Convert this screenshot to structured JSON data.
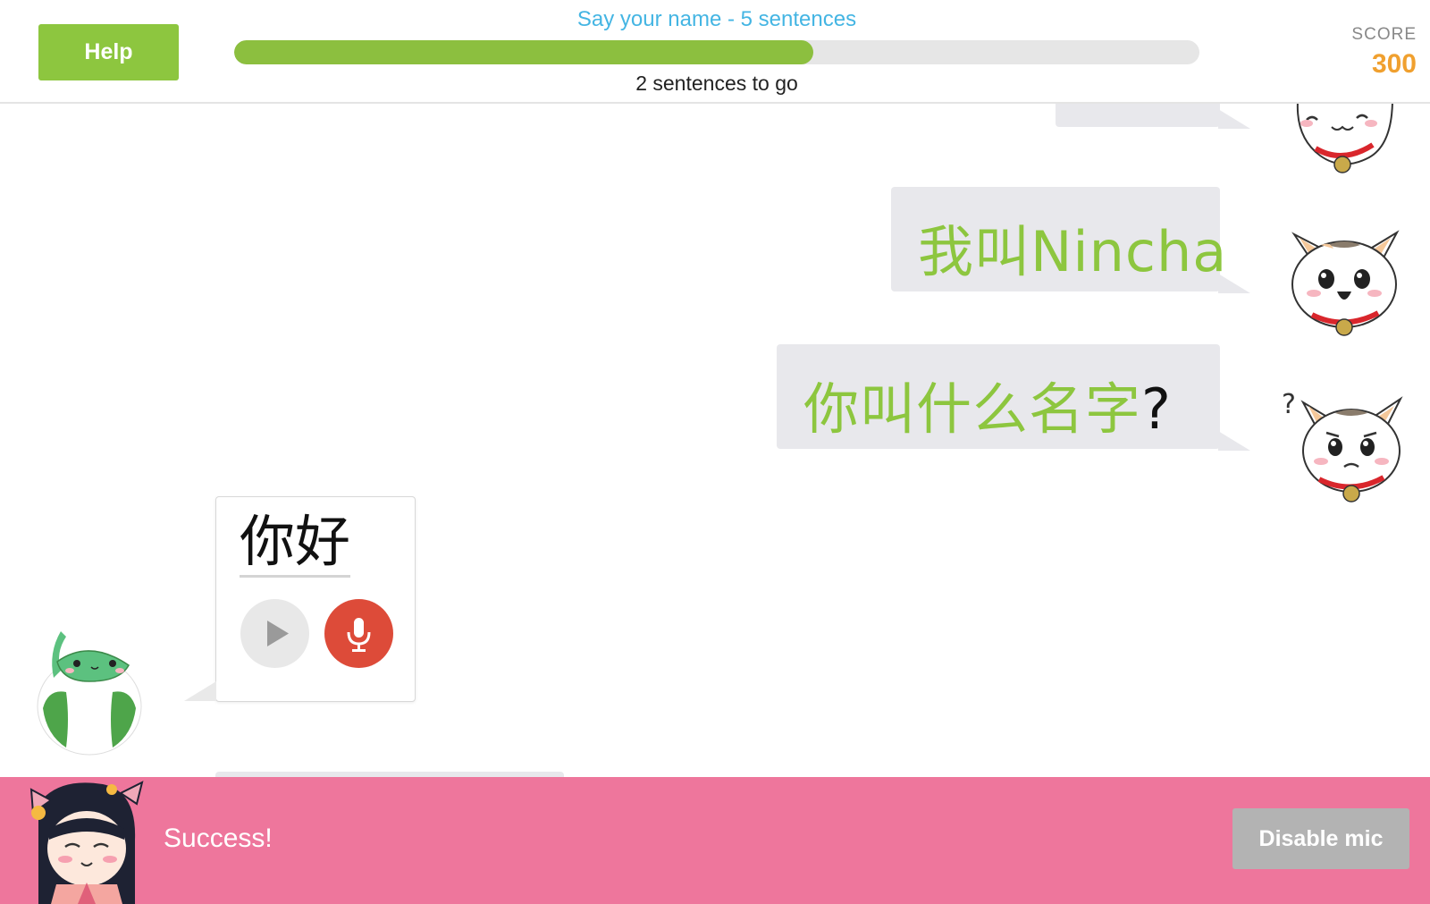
{
  "header": {
    "help_label": "Help",
    "lesson_title": "Say your name - 5 sentences",
    "progress_text": "2 sentences to go",
    "progress_fraction": 0.6,
    "score_label": "SCORE",
    "score_value": "300"
  },
  "conversation": {
    "messages": [
      {
        "speaker": "cat",
        "text": "我叫Nincha",
        "punct": ""
      },
      {
        "speaker": "cat",
        "text": "你叫什么名字",
        "punct": "?"
      }
    ],
    "response_card": {
      "text": "你好"
    }
  },
  "banner": {
    "message": "Success!",
    "disable_mic_label": "Disable mic"
  },
  "colors": {
    "accent_green": "#8dc63f",
    "title_blue": "#44b5e3",
    "score_orange": "#f0a02f",
    "banner_pink": "#ee769c",
    "mic_red": "#dd4b39"
  }
}
